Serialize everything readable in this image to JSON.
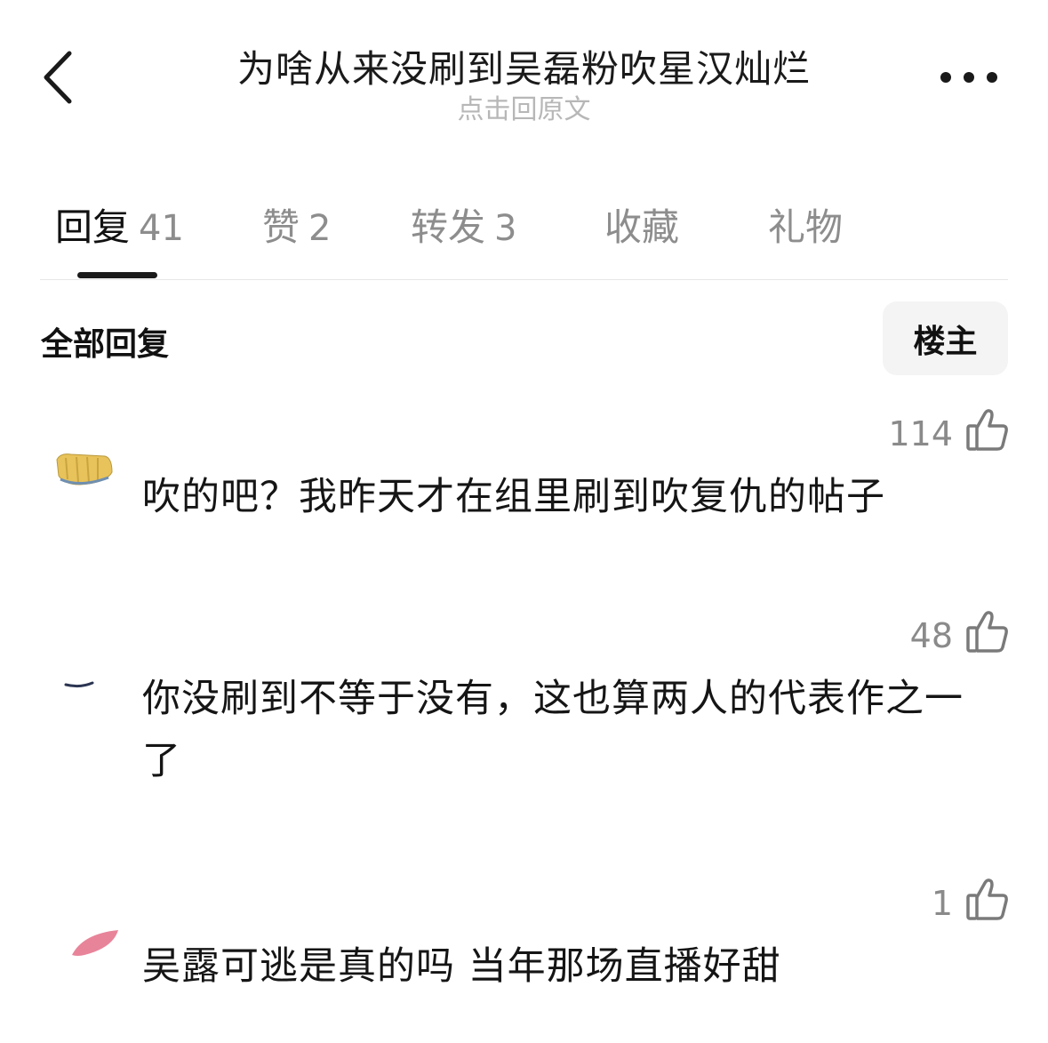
{
  "header": {
    "back_icon": "chevron-left-icon",
    "title": "为啥从来没刷到吴磊粉吹星汉灿烂",
    "subtitle": "点击回原文",
    "more_icon": "more-horizontal-icon"
  },
  "tabs": [
    {
      "label": "回复",
      "count": "41",
      "active": true
    },
    {
      "label": "赞",
      "count": "2",
      "active": false
    },
    {
      "label": "转发",
      "count": "3",
      "active": false
    },
    {
      "label": "收藏",
      "count": "",
      "active": false
    },
    {
      "label": "礼物",
      "count": "",
      "active": false
    }
  ],
  "section": {
    "title": "全部回复",
    "filter_label": "楼主"
  },
  "comments": [
    {
      "likes": "114",
      "text": "吹的吧？我昨天才在组里刷到吹复仇的帖子",
      "like_icon": "thumbs-up-icon"
    },
    {
      "likes": "48",
      "text": "你没刷到不等于没有，这也算两人的代表作之一了",
      "like_icon": "thumbs-up-icon"
    },
    {
      "likes": "1",
      "text": "吴露可逃是真的吗  当年那场直播好甜",
      "like_icon": "thumbs-up-icon"
    }
  ],
  "colors": {
    "text_primary": "#111111",
    "text_secondary": "#8a8a8a",
    "subtitle": "#b7b7b7",
    "indicator": "#1a1a1a",
    "filter_bg": "#f4f4f4"
  }
}
